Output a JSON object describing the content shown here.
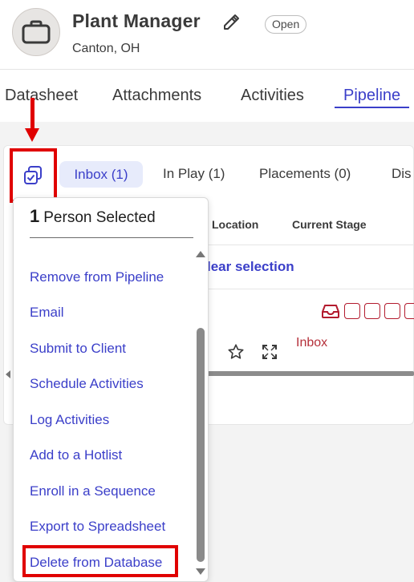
{
  "header": {
    "title": "Plant Manager",
    "status": "Open",
    "location": "Canton, OH"
  },
  "main_tabs": [
    {
      "label": "Datasheet"
    },
    {
      "label": "Attachments"
    },
    {
      "label": "Activities"
    },
    {
      "label": "Pipeline",
      "active": true
    }
  ],
  "pipeline_tabs": [
    {
      "label": "Inbox (1)",
      "active": true
    },
    {
      "label": "In Play (1)"
    },
    {
      "label": "Placements (0)"
    },
    {
      "label": "Dis"
    }
  ],
  "table": {
    "columns": [
      "Location",
      "Current Stage"
    ],
    "clear_selection": "lear selection",
    "row": {
      "stage": "Inbox"
    }
  },
  "dropdown": {
    "count": "1",
    "header_label": "Person Selected",
    "items": [
      {
        "label": "Remove from Pipeline"
      },
      {
        "label": "Email"
      },
      {
        "label": "Submit to Client"
      },
      {
        "label": "Schedule Activities"
      },
      {
        "label": "Log Activities"
      },
      {
        "label": "Add to a Hotlist"
      },
      {
        "label": "Enroll in a Sequence"
      },
      {
        "label": "Export to Spreadsheet"
      },
      {
        "label": "Delete from Database",
        "highlighted": true
      }
    ]
  },
  "icons": {
    "avatar": "briefcase-icon",
    "edit": "pencil-icon",
    "bulk_action": "copy-check-icon",
    "inbox": "inbox-tray-icon",
    "star": "star-icon",
    "expand": "expand-icon"
  },
  "colors": {
    "accent": "#3b3fc9",
    "annotation_red": "#e00000",
    "stage_red": "#b5303a"
  }
}
